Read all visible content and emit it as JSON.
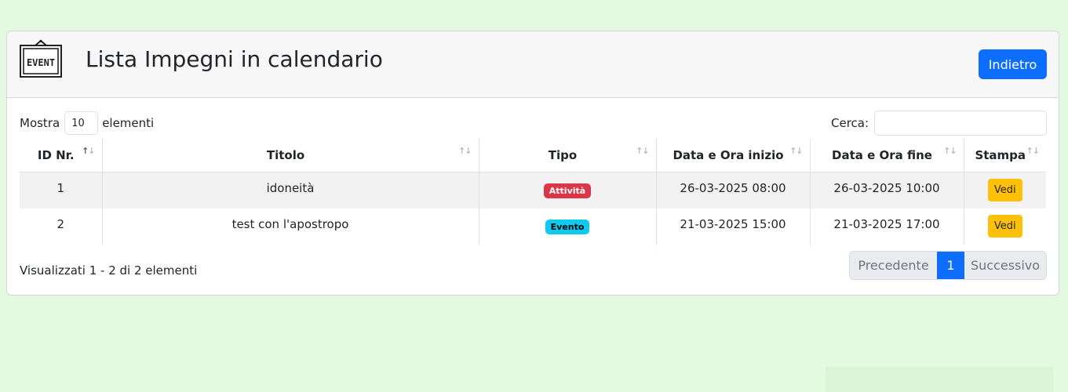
{
  "header": {
    "title": "Lista Impegni in calendario",
    "logo_text": "EVENT",
    "back_label": "Indietro"
  },
  "controls": {
    "show_label": "Mostra",
    "page_size": "10",
    "elements_label": "elementi",
    "search_label": "Cerca:",
    "search_value": ""
  },
  "table": {
    "columns": [
      "ID Nr.",
      "Titolo",
      "Tipo",
      "Data e Ora inizio",
      "Data e Ora fine",
      "Stampa"
    ],
    "rows": [
      {
        "id": "1",
        "titolo": "idoneità",
        "tipo": "Attività",
        "tipo_color": "#dc3545",
        "inizio": "26-03-2025 08:00",
        "fine": "26-03-2025 10:00",
        "stampa": "Vedi"
      },
      {
        "id": "2",
        "titolo": "test con l'apostropo",
        "tipo": "Evento",
        "tipo_color": "#0dcaf0",
        "inizio": "21-03-2025 15:00",
        "fine": "21-03-2025 17:00",
        "stampa": "Vedi"
      }
    ]
  },
  "footer": {
    "info": "Visualizzati 1 - 2 di 2 elementi",
    "prev_label": "Precedente",
    "current_page": "1",
    "next_label": "Successivo"
  },
  "colors": {
    "page_bg": "#e4fae0",
    "primary": "#0d6efd",
    "warning": "#ffc107"
  }
}
